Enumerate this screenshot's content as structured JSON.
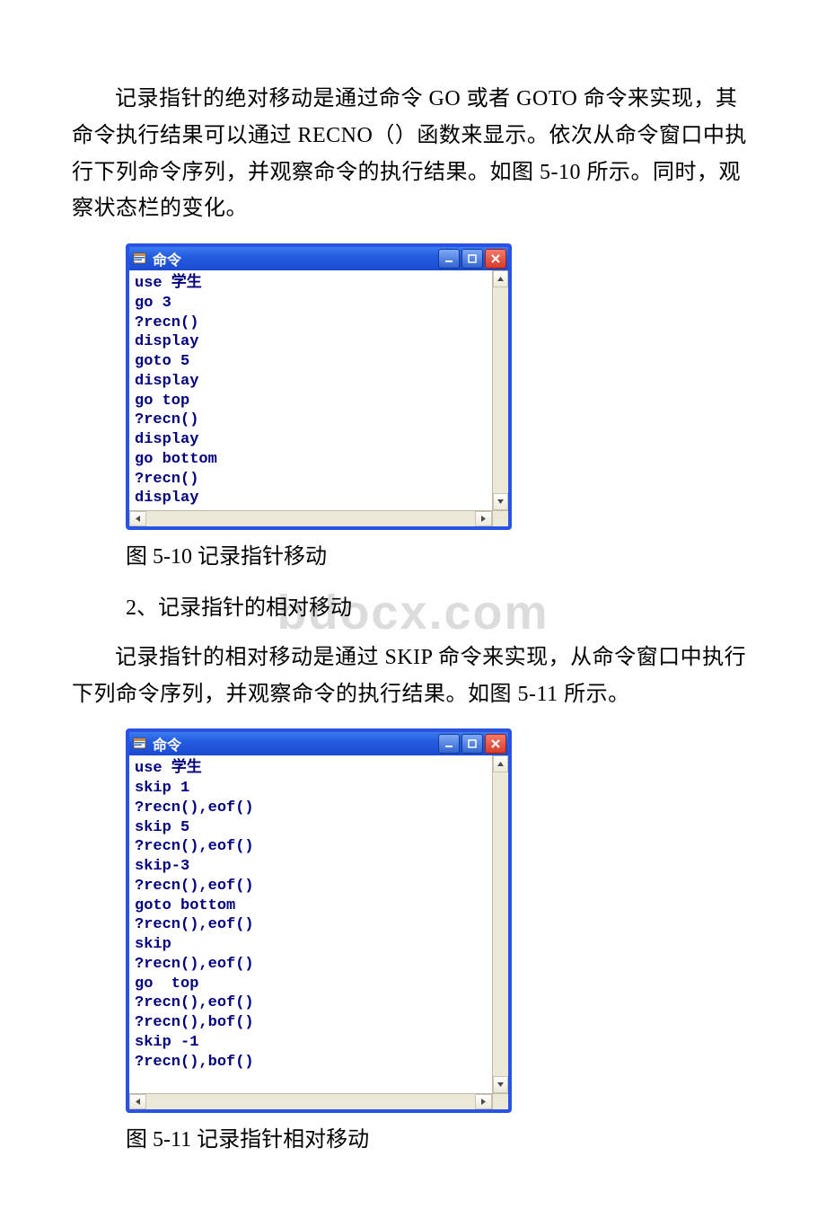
{
  "para1": "记录指针的绝对移动是通过命令 GO 或者 GOTO 命令来实现，其命令执行结果可以通过 RECNO（）函数来显示。依次从命令窗口中执行下列命令序列，并观察命令的执行结果。如图 5-10 所示。同时，观察状态栏的变化。",
  "window1": {
    "title": "命令",
    "lines": "use 学生\ngo 3\n?recn()\ndisplay\ngoto 5\ndisplay\ngo top\n?recn()\ndisplay\ngo bottom\n?recn()\ndisplay"
  },
  "caption1": "图 5-10 记录指针移动",
  "subheading2": "2、记录指针的相对移动",
  "para2": "记录指针的相对移动是通过 SKIP 命令来实现，从命令窗口中执行下列命令序列，并观察命令的执行结果。如图 5-11 所示。",
  "window2": {
    "title": "命令",
    "lines": "use 学生\nskip 1\n?recn(),eof()\nskip 5\n?recn(),eof()\nskip-3\n?recn(),eof()\ngoto bottom\n?recn(),eof()\nskip\n?recn(),eof()\ngo  top\n?recn(),eof()\n?recn(),bof()\nskip -1\n?recn(),bof()\n "
  },
  "caption2": "图 5-11 记录指针相对移动",
  "watermark": "bdocx.com"
}
